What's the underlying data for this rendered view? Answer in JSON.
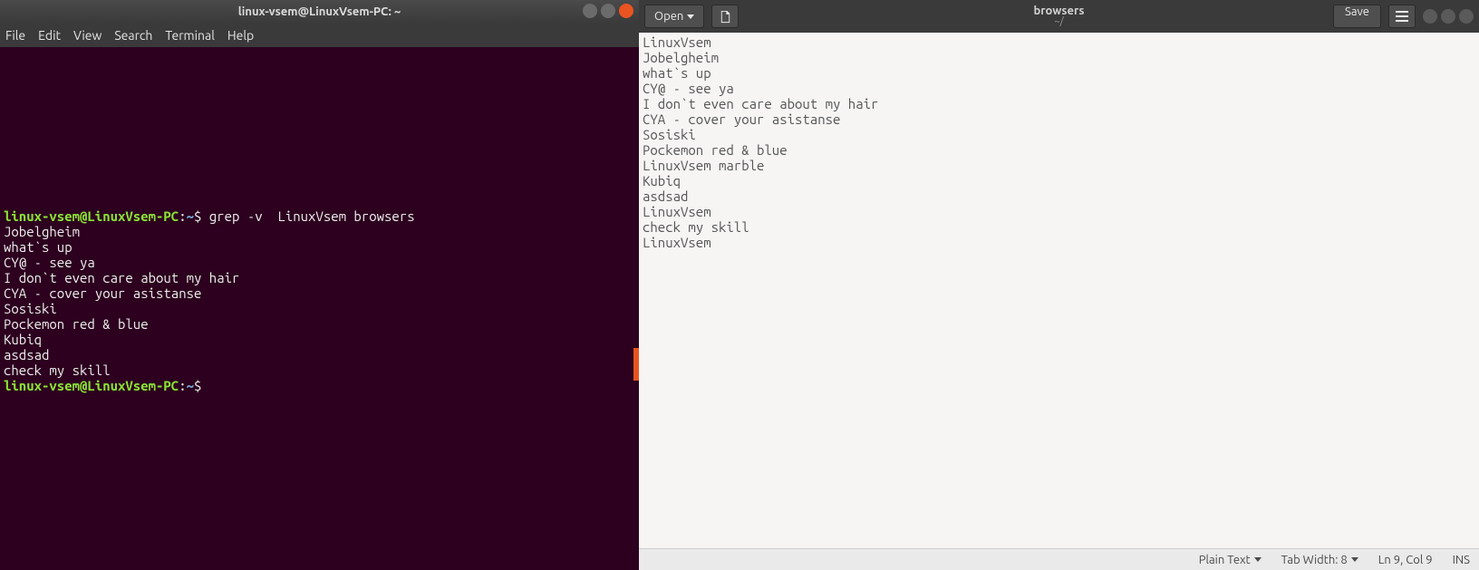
{
  "terminal": {
    "title": "linux-vsem@LinuxVsem-PC: ~",
    "menu": [
      "File",
      "Edit",
      "View",
      "Search",
      "Terminal",
      "Help"
    ],
    "prompt_user_host": "linux-vsem@LinuxVsem-PC",
    "prompt_path": "~",
    "prompt_symbol": "$",
    "command": "grep -v  LinuxVsem browsers",
    "output": [
      "Jobelgheim",
      "what`s up",
      "CY@ - see ya",
      "I don`t even care about my hair",
      "CYA - cover your asistanse",
      "Sosiski",
      "Pockemon red & blue",
      "Kubiq",
      "asdsad",
      "check my skill"
    ]
  },
  "editor": {
    "open_label": "Open",
    "title": "browsers",
    "subtitle": "~/",
    "save_label": "Save",
    "lines": [
      "LinuxVsem",
      "Jobelgheim",
      "what`s up",
      "CY@ - see ya",
      "I don`t even care about my hair",
      "CYA - cover your asistanse",
      "Sosiski",
      "Pockemon red & blue",
      "LinuxVsem marble",
      "Kubiq",
      "asdsad",
      "LinuxVsem",
      "check my skill",
      "LinuxVsem"
    ],
    "status": {
      "syntax": "Plain Text",
      "tab_width": "Tab Width: 8",
      "position": "Ln 9, Col 9",
      "insert_mode": "INS"
    }
  }
}
